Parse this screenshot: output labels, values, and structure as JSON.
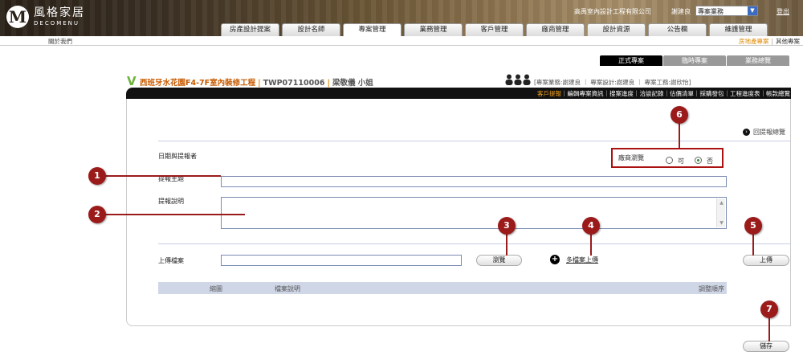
{
  "header": {
    "logo_cn": "風格家居",
    "logo_en": "DECOMENU",
    "logo_mark": "M",
    "company": "高禹室內設計工程有限公司",
    "user": "謝建良",
    "role_select": "專案業務",
    "logout": "登出",
    "nav": [
      "房產設計提案",
      "設計名師",
      "專案管理",
      "業務管理",
      "客戶管理",
      "廠商管理",
      "設計資源",
      "公告欄",
      "維護管理"
    ]
  },
  "subbar": {
    "about": "關於我們",
    "link_active": "房地產專案",
    "sep": "|",
    "link_other": "其他專案"
  },
  "project_tabs": [
    "正式專案",
    "臨時專案",
    "業務總覽"
  ],
  "project": {
    "mark": "V",
    "name": "西班牙水花園F4-7F室內裝修工程",
    "sep": "|",
    "code": "TWP07110006",
    "owner": "梁敬儀 小姐",
    "staff": "[專案業務:謝建良 ｜ 專案設計:謝建良 ｜ 專案工務:謝欣怡]"
  },
  "sublinks": {
    "active": "客戶提報",
    "rest": "｜編輯專案資訊｜搜案進度｜洽談記錄｜估價清單｜採購發包｜工程進度表｜帳款總覽"
  },
  "form": {
    "back_link": "回提報總覽",
    "date_label": "日期與提報者",
    "vendor_label": "廠商瀏覽",
    "radio_yes": "可",
    "radio_no": "否",
    "subject_label": "提報主題",
    "desc_label": "提報說明",
    "upload_label": "上傳檔案",
    "browse_button": "瀏覽",
    "multi_upload": "多檔案上傳",
    "upload_button": "上傳",
    "table_headers": [
      "縮圖",
      "檔案說明",
      "調整順序"
    ],
    "save_button": "儲存",
    "plus_icon": "+"
  },
  "callouts": [
    "1",
    "2",
    "3",
    "4",
    "5",
    "6",
    "7"
  ],
  "colors": {
    "callout": "#9b1b1b",
    "orange": "#e08a00",
    "green_mark": "#6db33f"
  }
}
